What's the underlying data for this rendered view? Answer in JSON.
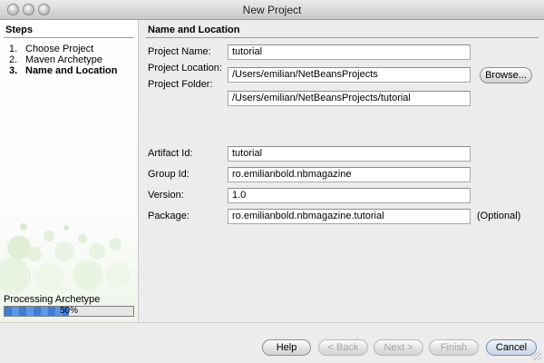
{
  "window": {
    "title": "New Project"
  },
  "steps": {
    "title": "Steps",
    "items": [
      {
        "num": "1.",
        "label": "Choose Project"
      },
      {
        "num": "2.",
        "label": "Maven Archetype"
      },
      {
        "num": "3.",
        "label": "Name and Location"
      }
    ],
    "current_index": 2
  },
  "progress": {
    "label": "Processing Archetype",
    "value_percent": 50,
    "text": "50%"
  },
  "form": {
    "section_title": "Name and Location",
    "project_name_label": "Project Name:",
    "project_name_value": "tutorial",
    "project_location_label": "Project Location:",
    "project_location_value": "/Users/emilian/NetBeansProjects",
    "browse_label": "Browse...",
    "project_folder_label": "Project Folder:",
    "project_folder_value": "/Users/emilian/NetBeansProjects/tutorial",
    "artifact_id_label": "Artifact Id:",
    "artifact_id_value": "tutorial",
    "group_id_label": "Group Id:",
    "group_id_value": "ro.emilianbold.nbmagazine",
    "version_label": "Version:",
    "version_value": "1.0",
    "package_label": "Package:",
    "package_value": "ro.emilianbold.nbmagazine.tutorial",
    "optional_label": "(Optional)"
  },
  "buttons": {
    "help": "Help",
    "back": "< Back",
    "next": "Next >",
    "finish": "Finish",
    "cancel": "Cancel"
  }
}
